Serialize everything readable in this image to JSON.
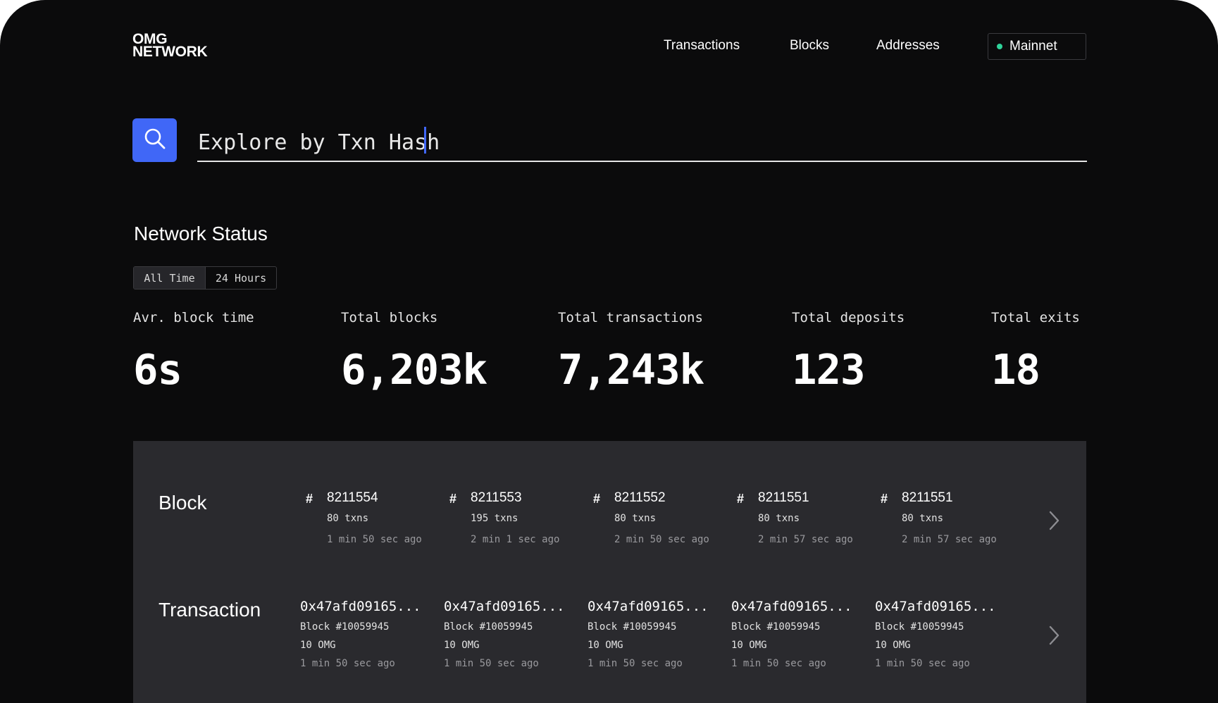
{
  "logo": {
    "line1": "OMG",
    "line2": "NETWORK"
  },
  "nav": {
    "transactions": "Transactions",
    "blocks": "Blocks",
    "addresses": "Addresses"
  },
  "network": {
    "label": "Mainnet",
    "status_color": "#2fd39a"
  },
  "search": {
    "placeholder": "Explore by Txn Hash",
    "value": "",
    "icon": "search-icon",
    "accent": "#4067f7"
  },
  "status": {
    "title": "Network Status",
    "toggle": {
      "all_time": "All Time",
      "hours_24": "24 Hours",
      "selected": "All Time"
    },
    "stats": [
      {
        "label": "Avr. block time",
        "value": "6s"
      },
      {
        "label": "Total blocks",
        "value": "6,203k"
      },
      {
        "label": "Total transactions",
        "value": "7,243k"
      },
      {
        "label": "Total deposits",
        "value": "123"
      },
      {
        "label": "Total exits",
        "value": "18"
      }
    ]
  },
  "feed": {
    "block_title": "Block",
    "transaction_title": "Transaction",
    "blocks": [
      {
        "number": "8211554",
        "txns": "80 txns",
        "time": "1 min 50 sec ago"
      },
      {
        "number": "8211553",
        "txns": "195 txns",
        "time": "2 min 1 sec ago"
      },
      {
        "number": "8211552",
        "txns": "80 txns",
        "time": "2 min 50 sec ago"
      },
      {
        "number": "8211551",
        "txns": "80 txns",
        "time": "2 min 57 sec ago"
      },
      {
        "number": "8211551",
        "txns": "80 txns",
        "time": "2 min 57 sec ago"
      }
    ],
    "transactions": [
      {
        "hash": "0x47afd09165...",
        "block": "Block #10059945",
        "amount": "10 OMG",
        "time": "1 min 50 sec ago"
      },
      {
        "hash": "0x47afd09165...",
        "block": "Block #10059945",
        "amount": "10 OMG",
        "time": "1 min 50 sec ago"
      },
      {
        "hash": "0x47afd09165...",
        "block": "Block #10059945",
        "amount": "10 OMG",
        "time": "1 min 50 sec ago"
      },
      {
        "hash": "0x47afd09165...",
        "block": "Block #10059945",
        "amount": "10 OMG",
        "time": "1 min 50 sec ago"
      },
      {
        "hash": "0x47afd09165...",
        "block": "Block #10059945",
        "amount": "10 OMG",
        "time": "1 min 50 sec ago"
      }
    ]
  }
}
